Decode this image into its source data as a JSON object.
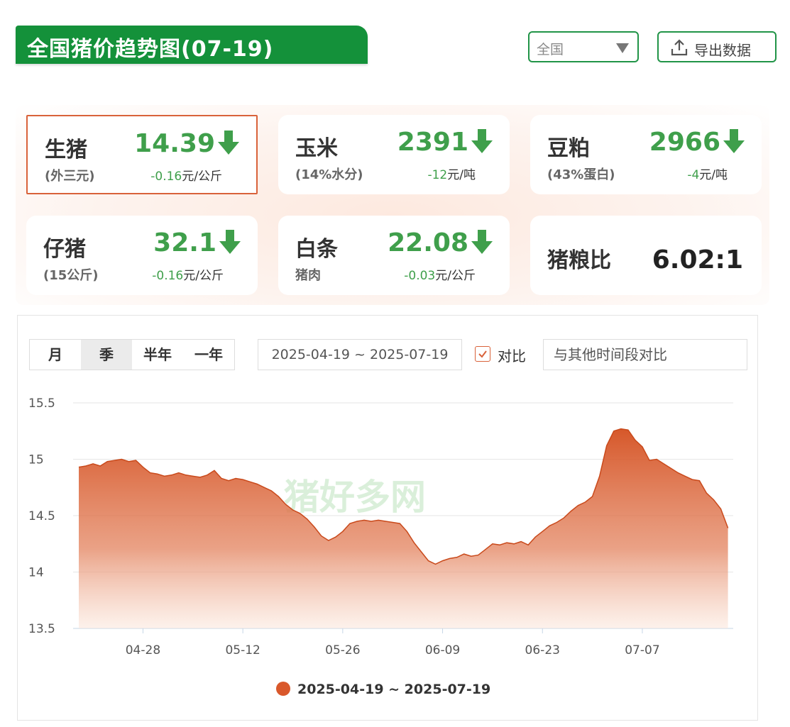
{
  "header": {
    "title": "全国猪价趋势图(07-19)",
    "region_select": "全国",
    "export_label": "导出数据"
  },
  "cards": [
    {
      "name": "生猪",
      "sub": "(外三元)",
      "price": "14.39",
      "change_num": "-0.16",
      "unit": "元/公斤"
    },
    {
      "name": "玉米",
      "sub": "(14%水分)",
      "price": "2391",
      "change_num": "-12",
      "unit": "元/吨"
    },
    {
      "name": "豆粕",
      "sub": "(43%蛋白)",
      "price": "2966",
      "change_num": "-4",
      "unit": "元/吨"
    },
    {
      "name": "仔猪",
      "sub": "(15公斤)",
      "price": "32.1",
      "change_num": "-0.16",
      "unit": "元/公斤"
    },
    {
      "name": "白条",
      "sub": "猪肉",
      "price": "22.08",
      "change_num": "-0.03",
      "unit": "元/公斤"
    },
    {
      "name": "猪粮比",
      "ratio": "6.02:1"
    }
  ],
  "chart_panel": {
    "tabs": [
      "月",
      "季",
      "半年",
      "一年"
    ],
    "selected_tab": "季",
    "date_range": "2025-04-19 ~ 2025-07-19",
    "compare_label": "对比",
    "compare_checked": true,
    "compare_placeholder": "与其他时间段对比"
  },
  "colors": {
    "brand_green": "#14913a",
    "down_green": "#3f9f4b",
    "series_orange": "#d9623a"
  },
  "chart_data": {
    "type": "area",
    "start_date": "2025-04-19",
    "ylim": [
      13.5,
      15.5
    ],
    "yticks": [
      13.5,
      14,
      14.5,
      15,
      15.5
    ],
    "xtick_labels": [
      "04-28",
      "05-12",
      "05-26",
      "06-09",
      "06-23",
      "07-07"
    ],
    "grid": true,
    "legend_position": "bottom",
    "series": [
      {
        "name": "2025-04-19 ~ 2025-07-19",
        "x": [
          "2025-04-19",
          "2025-04-20",
          "2025-04-21",
          "2025-04-22",
          "2025-04-23",
          "2025-04-24",
          "2025-04-25",
          "2025-04-26",
          "2025-04-27",
          "2025-04-28",
          "2025-04-29",
          "2025-04-30",
          "2025-05-01",
          "2025-05-02",
          "2025-05-03",
          "2025-05-04",
          "2025-05-05",
          "2025-05-06",
          "2025-05-07",
          "2025-05-08",
          "2025-05-09",
          "2025-05-10",
          "2025-05-11",
          "2025-05-12",
          "2025-05-13",
          "2025-05-14",
          "2025-05-15",
          "2025-05-16",
          "2025-05-17",
          "2025-05-18",
          "2025-05-19",
          "2025-05-20",
          "2025-05-21",
          "2025-05-22",
          "2025-05-23",
          "2025-05-24",
          "2025-05-25",
          "2025-05-26",
          "2025-05-27",
          "2025-05-28",
          "2025-05-29",
          "2025-05-30",
          "2025-05-31",
          "2025-06-01",
          "2025-06-02",
          "2025-06-03",
          "2025-06-04",
          "2025-06-05",
          "2025-06-06",
          "2025-06-07",
          "2025-06-08",
          "2025-06-09",
          "2025-06-10",
          "2025-06-11",
          "2025-06-12",
          "2025-06-13",
          "2025-06-14",
          "2025-06-15",
          "2025-06-16",
          "2025-06-17",
          "2025-06-18",
          "2025-06-19",
          "2025-06-20",
          "2025-06-21",
          "2025-06-22",
          "2025-06-23",
          "2025-06-24",
          "2025-06-25",
          "2025-06-26",
          "2025-06-27",
          "2025-06-28",
          "2025-06-29",
          "2025-06-30",
          "2025-07-01",
          "2025-07-02",
          "2025-07-03",
          "2025-07-04",
          "2025-07-05",
          "2025-07-06",
          "2025-07-07",
          "2025-07-08",
          "2025-07-09",
          "2025-07-10",
          "2025-07-11",
          "2025-07-12",
          "2025-07-13",
          "2025-07-14",
          "2025-07-15",
          "2025-07-16",
          "2025-07-17",
          "2025-07-18",
          "2025-07-19"
        ],
        "values": [
          14.93,
          14.94,
          14.96,
          14.94,
          14.98,
          14.99,
          15.0,
          14.98,
          14.99,
          14.93,
          14.88,
          14.87,
          14.85,
          14.86,
          14.88,
          14.86,
          14.85,
          14.84,
          14.86,
          14.9,
          14.83,
          14.81,
          14.83,
          14.82,
          14.8,
          14.78,
          14.75,
          14.72,
          14.67,
          14.6,
          14.55,
          14.52,
          14.47,
          14.4,
          14.32,
          14.28,
          14.31,
          14.36,
          14.43,
          14.45,
          14.46,
          14.45,
          14.46,
          14.45,
          14.44,
          14.43,
          14.36,
          14.26,
          14.18,
          14.1,
          14.07,
          14.1,
          14.12,
          14.13,
          14.16,
          14.14,
          14.15,
          14.2,
          14.25,
          14.24,
          14.26,
          14.25,
          14.27,
          14.24,
          14.31,
          14.36,
          14.41,
          14.44,
          14.48,
          14.54,
          14.59,
          14.62,
          14.67,
          14.85,
          15.12,
          15.25,
          15.27,
          15.26,
          15.17,
          15.11,
          14.99,
          15.0,
          14.96,
          14.92,
          14.88,
          14.85,
          14.82,
          14.81,
          14.7,
          14.64,
          14.56,
          14.39
        ]
      }
    ]
  }
}
